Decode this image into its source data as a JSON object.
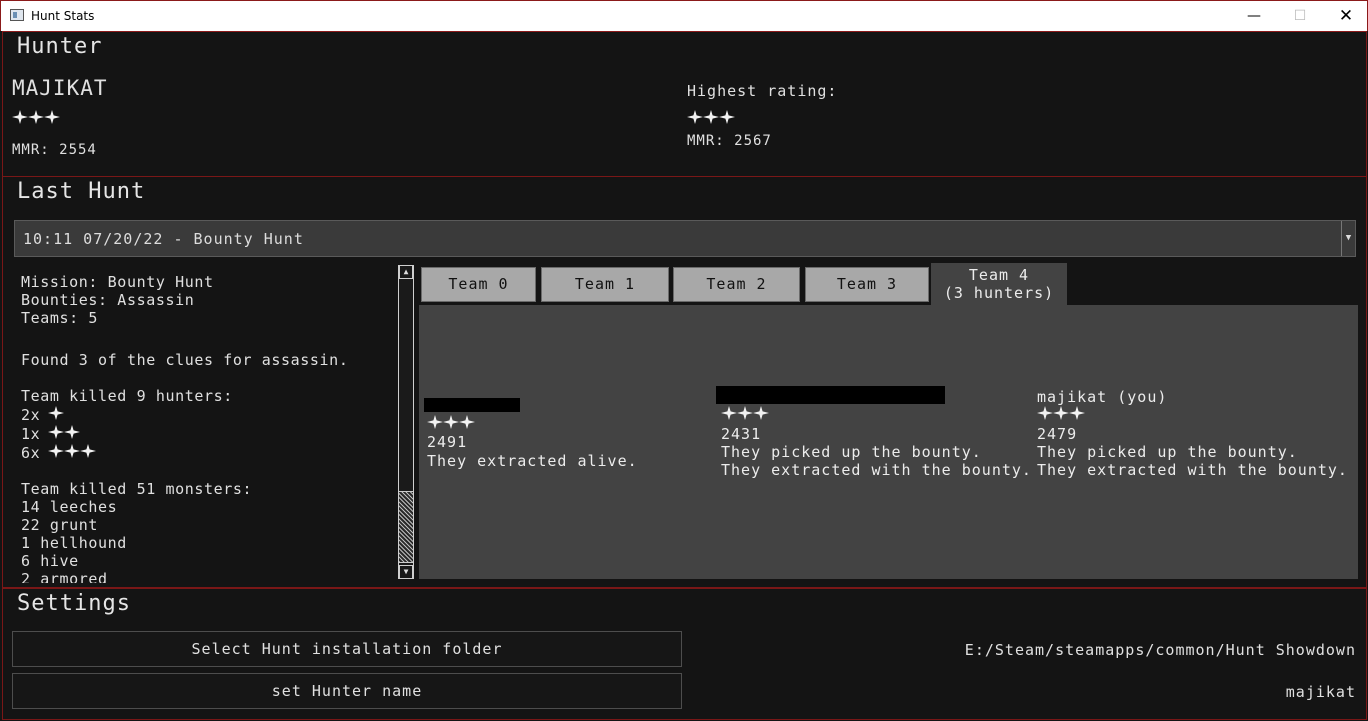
{
  "window": {
    "title": "Hunt Stats"
  },
  "hunter": {
    "section_title": "Hunter",
    "name": "MAJIKAT",
    "stars": 3,
    "mmr": "MMR: 2554",
    "highest_label": "Highest rating:",
    "highest_stars": 3,
    "highest_mmr": "MMR: 2567"
  },
  "last_hunt": {
    "section_title": "Last Hunt",
    "selected_hunt": "10:11 07/20/22 - Bounty Hunt",
    "summary": {
      "mission": "Mission: Bounty Hunt",
      "bounties": "Bounties: Assassin",
      "teams": "Teams: 5",
      "clues": "Found 3 of the clues for assassin.",
      "hunters_header": "Team killed 9 hunters:",
      "hunter_kills": [
        {
          "count": "2x",
          "stars": 1
        },
        {
          "count": "1x",
          "stars": 2
        },
        {
          "count": "6x",
          "stars": 3
        }
      ],
      "monsters_header": "Team killed 51 monsters:",
      "monsters": [
        "14 leeches",
        "22 grunt",
        "1 hellhound",
        "6 hive",
        "2 armored"
      ]
    },
    "tabs": [
      {
        "label": "Team 0"
      },
      {
        "label": "Team 1"
      },
      {
        "label": "Team 2"
      },
      {
        "label": "Team 3"
      },
      {
        "label": "Team 4",
        "sublabel": "(3 hunters)",
        "active": true
      }
    ],
    "players": [
      {
        "name": "",
        "redacted": true,
        "stars": 3,
        "mmr": "2491",
        "notes": [
          "They extracted alive."
        ]
      },
      {
        "name": "",
        "redacted": true,
        "stars": 3,
        "mmr": "2431",
        "notes": [
          "They picked up the bounty.",
          "They extracted with the bounty."
        ]
      },
      {
        "name": "majikat (you)",
        "redacted": false,
        "stars": 3,
        "mmr": "2479",
        "notes": [
          "They picked up the bounty.",
          "They extracted with the bounty."
        ]
      }
    ]
  },
  "settings": {
    "section_title": "Settings",
    "folder_button": "Select Hunt installation folder",
    "folder_path": "E:/Steam/steamapps/common/Hunt Showdown",
    "name_button": "set Hunter name",
    "name_value": "majikat"
  },
  "icons": {
    "star": "star-icon",
    "dropdown": "chevron-down-icon"
  }
}
